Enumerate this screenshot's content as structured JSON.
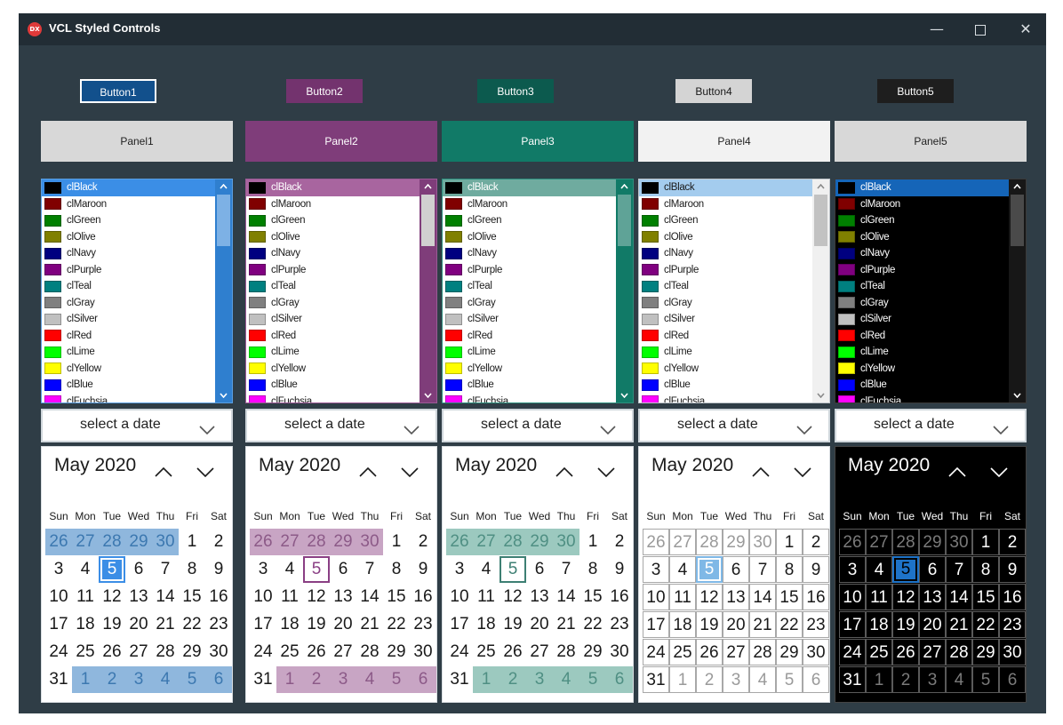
{
  "window": {
    "title": "VCL Styled Controls",
    "app_icon_text": "DX",
    "controls": [
      "minimize-icon",
      "maximize-icon",
      "close-icon"
    ]
  },
  "columns": [
    {
      "button": "Button1",
      "panel": "Panel1",
      "theme": {
        "btn_bg": "#12508c",
        "btn_fg": "#ffffff",
        "btn_border": "#ffffff",
        "panel_bg": "#d8d8d8",
        "panel_fg": "#222222",
        "list_bg": "#ffffff",
        "list_fg": "#1a1a1a",
        "list_border": "#5a9ee0",
        "sel_bg": "#3b8ee6",
        "sel_fg": "#ffffff",
        "sb_bg": "#2f7fcf",
        "sb_thumb": "#7db1e5",
        "sb_arrow": "#ffffff",
        "cal_bg": "#ffffff",
        "cal_fg": "#1a1a1a",
        "cal_border": "#d8dde1",
        "adj_bg": "#8fb7dd",
        "adj_fg": "#3c78b0",
        "today_border": "#3b8ee6",
        "today_fill": "#3b8ee6",
        "today_fg": "#ffffff",
        "grid": "",
        "head_fg": "#1a1a1a"
      }
    },
    {
      "button": "Button2",
      "panel": "Panel2",
      "theme": {
        "btn_bg": "#73336e",
        "btn_fg": "#ffffff",
        "btn_border": "#73336e",
        "panel_bg": "#7f3d7a",
        "panel_fg": "#ffffff",
        "list_bg": "#ffffff",
        "list_fg": "#1a1a1a",
        "list_border": "#9b5a96",
        "sel_bg": "#a8659f",
        "sel_fg": "#ffffff",
        "sb_bg": "#7f3d7a",
        "sb_thumb": "#d0d0d0",
        "sb_arrow": "#ffffff",
        "cal_bg": "#ffffff",
        "cal_fg": "#1a1a1a",
        "cal_border": "#d8dde1",
        "adj_bg": "#c8a5c4",
        "adj_fg": "#8c5a88",
        "today_border": "#8a3f84",
        "today_fill": "#ffffff",
        "today_fg": "#8a3f84",
        "grid": "",
        "head_fg": "#1a1a1a"
      }
    },
    {
      "button": "Button3",
      "panel": "Panel3",
      "theme": {
        "btn_bg": "#0c5a4e",
        "btn_fg": "#ffffff",
        "btn_border": "#0c5a4e",
        "panel_bg": "#117a67",
        "panel_fg": "#ffffff",
        "list_bg": "#ffffff",
        "list_fg": "#1a1a1a",
        "list_border": "#2d8f7e",
        "sel_bg": "#6fab9f",
        "sel_fg": "#ffffff",
        "sb_bg": "#117a67",
        "sb_thumb": "#5fa397",
        "sb_arrow": "#ffffff",
        "cal_bg": "#ffffff",
        "cal_fg": "#1a1a1a",
        "cal_border": "#d8dde1",
        "adj_bg": "#9cc9bf",
        "adj_fg": "#4f8f83",
        "today_border": "#3d7f73",
        "today_fill": "#ffffff",
        "today_fg": "#3d7f73",
        "grid": "",
        "head_fg": "#1a1a1a"
      }
    },
    {
      "button": "Button4",
      "panel": "Panel4",
      "theme": {
        "btn_bg": "#d4d4d4",
        "btn_fg": "#1a1a1a",
        "btn_border": "#d4d4d4",
        "panel_bg": "#f2f2f2",
        "panel_fg": "#222222",
        "list_bg": "#ffffff",
        "list_fg": "#1a1a1a",
        "list_border": "#bfc5ca",
        "sel_bg": "#a4ccee",
        "sel_fg": "#1a1a1a",
        "sb_bg": "#f0f0f0",
        "sb_thumb": "#c2c2c2",
        "sb_arrow": "#8a8a8a",
        "cal_bg": "#ffffff",
        "cal_fg": "#1a1a1a",
        "cal_border": "#d8dde1",
        "adj_bg": "#ffffff",
        "adj_fg": "#9a9a9a",
        "today_border": "#7fb8e6",
        "today_fill": "#7fb8e6",
        "today_fg": "#ffffff",
        "grid": "#a8a8a8",
        "head_fg": "#1a1a1a"
      }
    },
    {
      "button": "Button5",
      "panel": "Panel5",
      "theme": {
        "btn_bg": "#1e1e1e",
        "btn_fg": "#ffffff",
        "btn_border": "#1e1e1e",
        "panel_bg": "#d8d8d8",
        "panel_fg": "#222222",
        "list_bg": "#000000",
        "list_fg": "#ffffff",
        "list_border": "#3a3a3a",
        "sel_bg": "#1565b8",
        "sel_fg": "#ffffff",
        "sb_bg": "#171717",
        "sb_thumb": "#4a4a4a",
        "sb_arrow": "#ffffff",
        "cal_bg": "#000000",
        "cal_fg": "#ffffff",
        "cal_border": "#444444",
        "adj_bg": "#000000",
        "adj_fg": "#7a7a7a",
        "today_border": "#1e73c8",
        "today_fill": "#1e73c8",
        "today_fg": "#000000",
        "grid": "#5a5a5a",
        "head_fg": "#ffffff"
      }
    }
  ],
  "color_items": [
    {
      "label": "clBlack",
      "color": "#000000"
    },
    {
      "label": "clMaroon",
      "color": "#800000"
    },
    {
      "label": "clGreen",
      "color": "#008000"
    },
    {
      "label": "clOlive",
      "color": "#808000"
    },
    {
      "label": "clNavy",
      "color": "#000080"
    },
    {
      "label": "clPurple",
      "color": "#800080"
    },
    {
      "label": "clTeal",
      "color": "#008080"
    },
    {
      "label": "clGray",
      "color": "#808080"
    },
    {
      "label": "clSilver",
      "color": "#c0c0c0"
    },
    {
      "label": "clRed",
      "color": "#ff0000"
    },
    {
      "label": "clLime",
      "color": "#00ff00"
    },
    {
      "label": "clYellow",
      "color": "#ffff00"
    },
    {
      "label": "clBlue",
      "color": "#0000ff"
    },
    {
      "label": "clFuchsia",
      "color": "#ff00ff"
    }
  ],
  "datepicker": {
    "placeholder": "select a date"
  },
  "calendar": {
    "month_label": "May 2020",
    "day_headers": [
      "Sun",
      "Mon",
      "Tue",
      "Wed",
      "Thu",
      "Fri",
      "Sat"
    ],
    "today": "5",
    "weeks": [
      [
        {
          "d": "26",
          "adj": true
        },
        {
          "d": "27",
          "adj": true
        },
        {
          "d": "28",
          "adj": true
        },
        {
          "d": "29",
          "adj": true
        },
        {
          "d": "30",
          "adj": true
        },
        {
          "d": "1"
        },
        {
          "d": "2"
        }
      ],
      [
        {
          "d": "3"
        },
        {
          "d": "4"
        },
        {
          "d": "5",
          "today": true
        },
        {
          "d": "6"
        },
        {
          "d": "7"
        },
        {
          "d": "8"
        },
        {
          "d": "9"
        }
      ],
      [
        {
          "d": "10"
        },
        {
          "d": "11"
        },
        {
          "d": "12"
        },
        {
          "d": "13"
        },
        {
          "d": "14"
        },
        {
          "d": "15"
        },
        {
          "d": "16"
        }
      ],
      [
        {
          "d": "17"
        },
        {
          "d": "18"
        },
        {
          "d": "19"
        },
        {
          "d": "20"
        },
        {
          "d": "21"
        },
        {
          "d": "22"
        },
        {
          "d": "23"
        }
      ],
      [
        {
          "d": "24"
        },
        {
          "d": "25"
        },
        {
          "d": "26"
        },
        {
          "d": "27"
        },
        {
          "d": "28"
        },
        {
          "d": "29"
        },
        {
          "d": "30"
        }
      ],
      [
        {
          "d": "31"
        },
        {
          "d": "1",
          "adj": true
        },
        {
          "d": "2",
          "adj": true
        },
        {
          "d": "3",
          "adj": true
        },
        {
          "d": "4",
          "adj": true
        },
        {
          "d": "5",
          "adj": true
        },
        {
          "d": "6",
          "adj": true
        }
      ]
    ]
  }
}
